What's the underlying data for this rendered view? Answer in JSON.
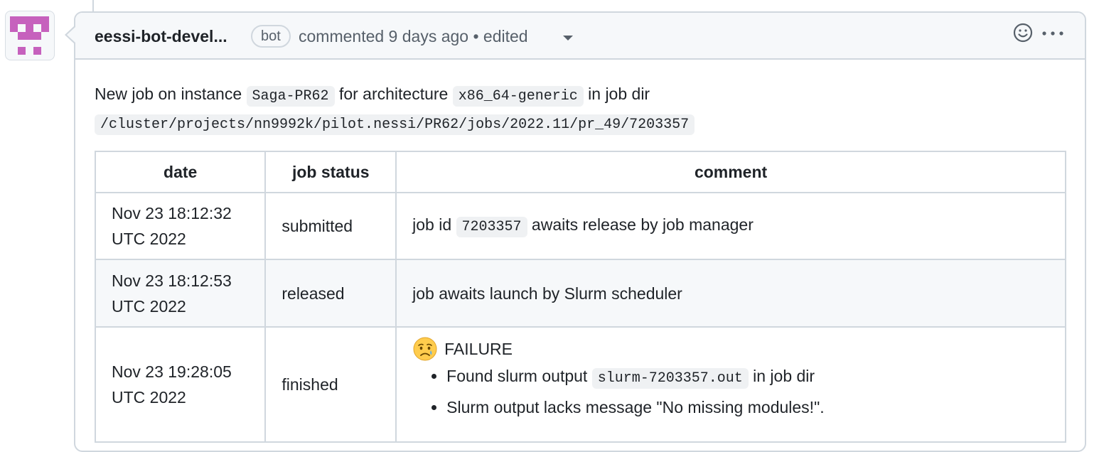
{
  "comment": {
    "author": "eessi-bot-devel...",
    "badge": "bot",
    "action": "commented 9 days ago • edited",
    "intro": {
      "text1": "New job on instance",
      "instance": "Saga-PR62",
      "text2": "for architecture",
      "arch": "x86_64-generic",
      "text3": "in job dir",
      "job_dir": "/cluster/projects/nn9992k/pilot.nessi/PR62/jobs/2022.11/pr_49/7203357"
    },
    "table": {
      "headers": [
        "date",
        "job status",
        "comment"
      ],
      "rows": [
        {
          "date": "Nov 23 18:12:32",
          "date2": "UTC 2022",
          "status": "submitted",
          "comment_pre": "job id",
          "comment_code": "7203357",
          "comment_post": "awaits release by job manager"
        },
        {
          "date": "Nov 23 18:12:53",
          "date2": "UTC 2022",
          "status": "released",
          "comment": "job awaits launch by Slurm scheduler"
        },
        {
          "date": "Nov 23 19:28:05",
          "date2": "UTC 2022",
          "status": "finished",
          "result": "FAILURE",
          "bullet1_pre": "Found slurm output",
          "bullet1_code": "slurm-7203357.out",
          "bullet1_post": "in job dir",
          "bullet2": "Slurm output lacks message \"No missing modules!\"."
        }
      ]
    }
  },
  "icons": {
    "avatar": "identicon",
    "reaction": "smiley-icon",
    "menu": "kebab-horizontal-icon",
    "edited_dropdown": "triangle-down-icon",
    "failure_emoji": "crying-face-icon"
  },
  "colors": {
    "avatar": "#c661bd",
    "border": "#d0d7de",
    "muted": "#57606a"
  }
}
